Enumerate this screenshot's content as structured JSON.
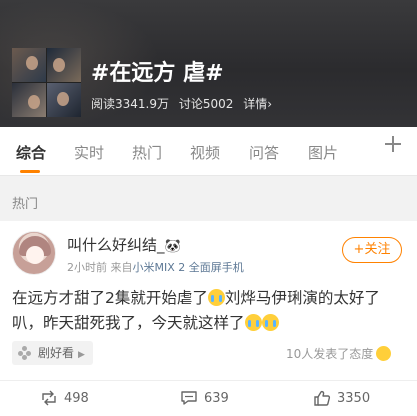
{
  "topic": {
    "title": "#在远方 虐#",
    "reads": "阅读3341.9万",
    "discussions": "讨论5002",
    "details": "详情›"
  },
  "tabs": [
    {
      "label": "综合",
      "active": true
    },
    {
      "label": "实时",
      "active": false
    },
    {
      "label": "热门",
      "active": false
    },
    {
      "label": "视频",
      "active": false
    },
    {
      "label": "问答",
      "active": false
    },
    {
      "label": "图片",
      "active": false
    }
  ],
  "section": {
    "label": "热门"
  },
  "post": {
    "username": "叫什么好纠结_",
    "time": "2小时前",
    "source_prefix": "来自",
    "source": "小米MIX 2 全面屏手机",
    "follow_label": "+关注",
    "text_part1": "在远方才甜了2集就开始虐了",
    "text_part2": "刘烨马伊琍演的太好了叭，昨天甜死我了，今天就这样了",
    "chip_label": "剧好看",
    "attitude_text": "10人发表了态度"
  },
  "actions": {
    "reposts": "498",
    "comments": "639",
    "likes": "3350"
  },
  "colors": {
    "accent": "#ff8200",
    "source_link": "#5d7895"
  }
}
